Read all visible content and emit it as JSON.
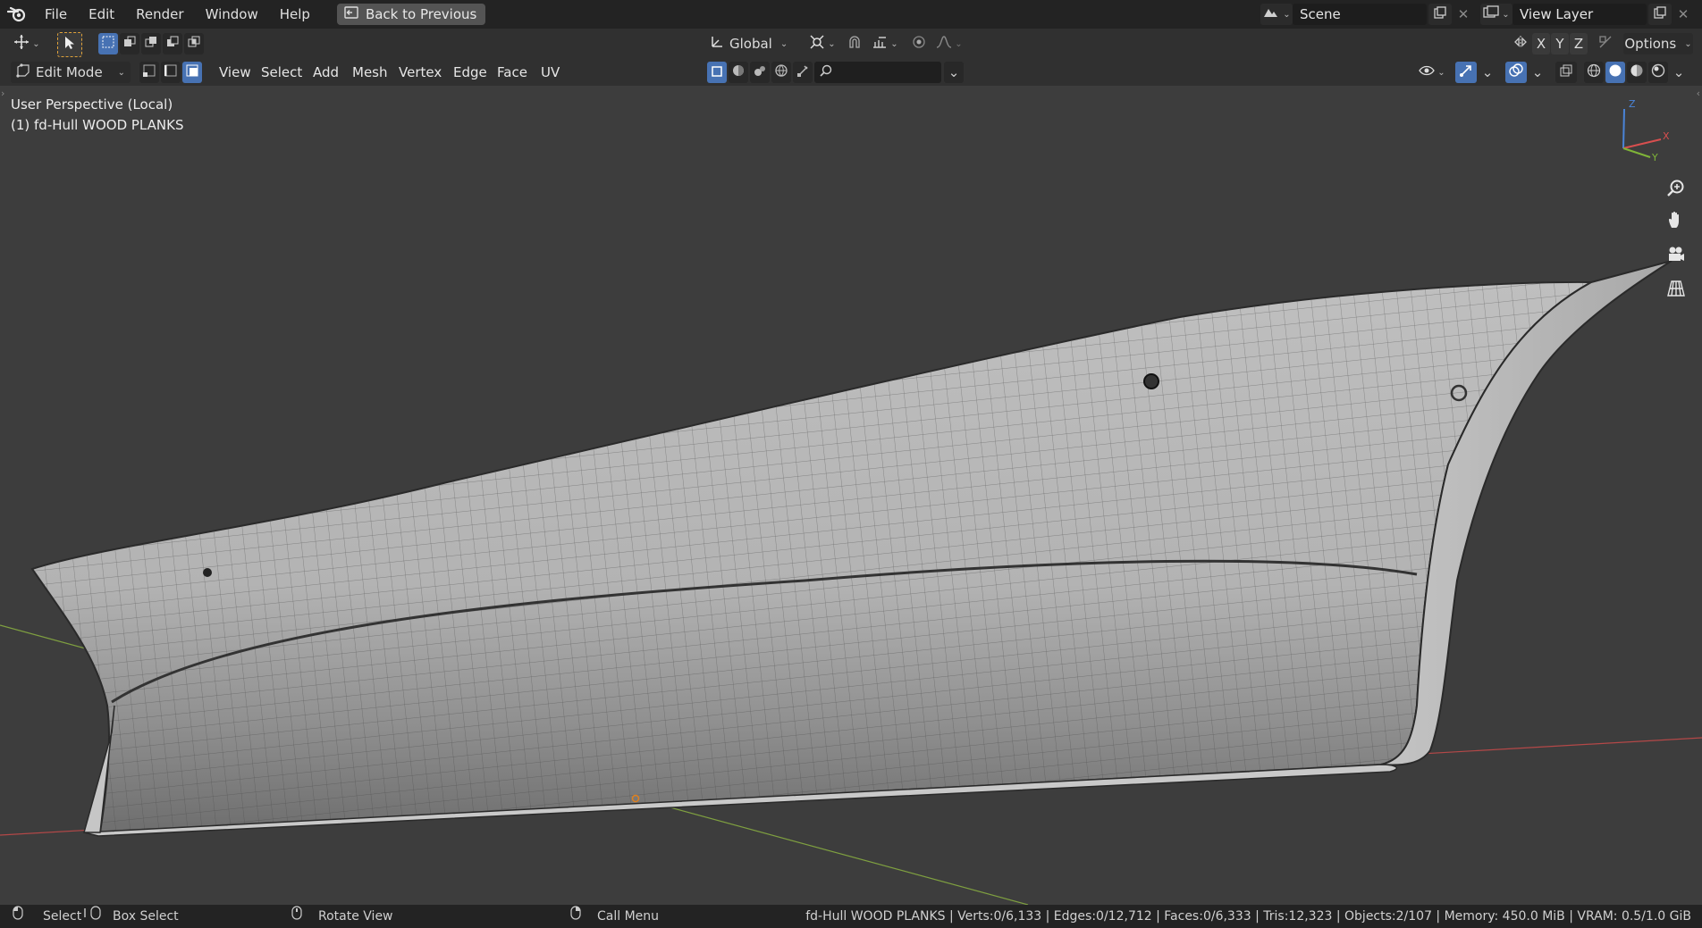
{
  "topbar": {
    "menus": [
      "File",
      "Edit",
      "Render",
      "Window",
      "Help"
    ],
    "back_button": "Back to Previous",
    "scene": "Scene",
    "view_layer": "View Layer"
  },
  "toolbar": {
    "transform_orientation": "Global",
    "axes": [
      "X",
      "Y",
      "Z"
    ],
    "options": "Options"
  },
  "header": {
    "mode": "Edit Mode",
    "menus": [
      "View",
      "Select",
      "Add",
      "Mesh",
      "Vertex",
      "Edge",
      "Face",
      "UV"
    ],
    "search_placeholder": ""
  },
  "viewport": {
    "perspective_label": "User Perspective (Local)",
    "object_label": "(1) fd-Hull WOOD PLANKS",
    "gizmo": {
      "x": "X",
      "y": "Y",
      "z": "Z"
    }
  },
  "statusbar": {
    "select": "Select",
    "box_select": "Box Select",
    "rotate_view": "Rotate View",
    "call_menu": "Call Menu",
    "stats": "fd-Hull WOOD PLANKS | Verts:0/6,133 | Edges:0/12,712 | Faces:0/6,333 | Tris:12,323 | Objects:2/107 | Memory: 450.0 MiB | VRAM: 0.5/1.0 GiB"
  },
  "colors": {
    "accent": "#4772b3",
    "background": "#3d3d3d",
    "axis_x": "#d84f4f",
    "axis_y": "#7fb438",
    "axis_z": "#4a84d8"
  }
}
